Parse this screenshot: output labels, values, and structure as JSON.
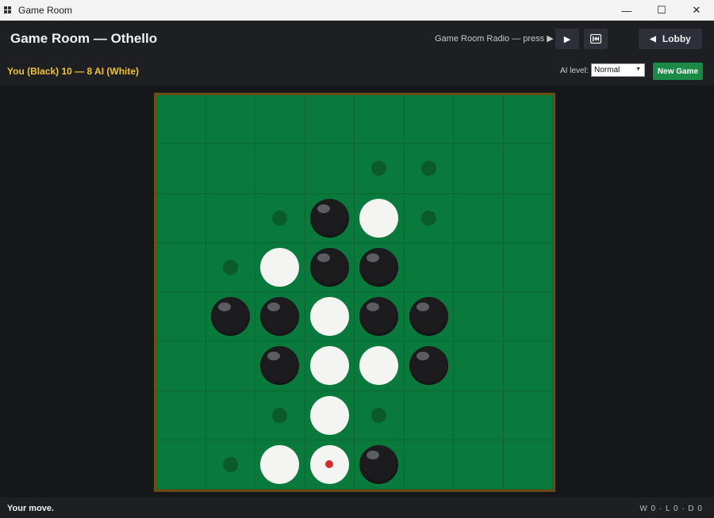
{
  "window": {
    "title": "Game Room"
  },
  "header": {
    "title": "Game Room — Othello",
    "radio_label": "Game Room Radio — press ▶",
    "lobby_label": "Lobby"
  },
  "score": {
    "text": "You (Black) 10 — 8 AI (White)",
    "black": 10,
    "white": 8
  },
  "controls": {
    "ai_level_label": "AI level:",
    "ai_level_value": "Normal",
    "new_game_label": "New Game"
  },
  "board": {
    "size": 8,
    "rows": [
      "........",
      "....hh..",
      "..hBWh..",
      ".hWBB...",
      ".BBWBB..",
      "..BWWB..",
      "..hWh...",
      ".hWLB..."
    ],
    "legend": {
      "B": "black disc",
      "W": "white disc",
      "h": "legal-move hint",
      "L": "white disc (last move marker)"
    }
  },
  "colors": {
    "board_green": "#0a7a3c",
    "board_frame": "#6b4c12",
    "accent_yellow": "#f1c232",
    "new_game_green": "#1b8a46",
    "last_move_red": "#d12f2f"
  },
  "status": {
    "message": "Your move.",
    "record": "W 0 · L 0 · D 0"
  }
}
